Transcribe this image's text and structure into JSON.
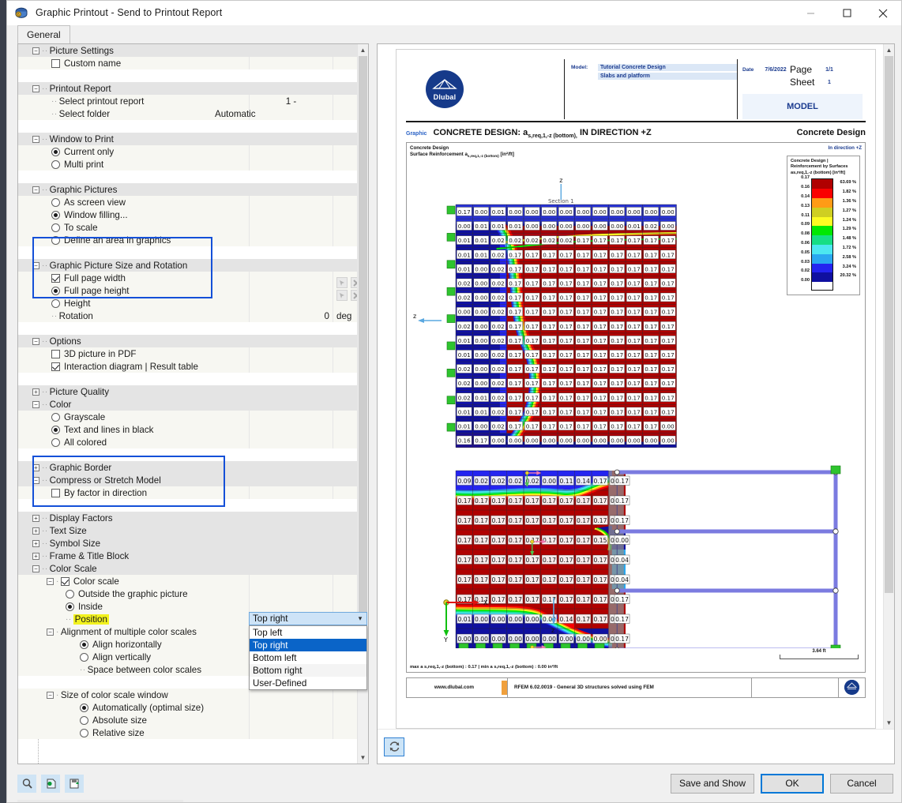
{
  "window": {
    "title": "Graphic Printout - Send to Printout Report",
    "icon": "printer-graphic-icon",
    "minimize": "—",
    "maximize": "☐",
    "close": "✕"
  },
  "tabs": [
    {
      "label": "General",
      "active": true
    }
  ],
  "tree": {
    "sections": [
      {
        "type": "group",
        "label": "Picture Settings",
        "expander": "−"
      },
      {
        "type": "check",
        "label": "Custom name",
        "checked": false
      },
      {
        "type": "blank"
      },
      {
        "type": "group",
        "label": "Printout Report",
        "expander": "−"
      },
      {
        "type": "text",
        "label": "Select printout report",
        "value": "1 -"
      },
      {
        "type": "text",
        "label": "Select folder",
        "value": "Automatic"
      },
      {
        "type": "blank"
      },
      {
        "type": "group",
        "label": "Window to Print",
        "expander": "−"
      },
      {
        "type": "radio",
        "label": "Current only",
        "checked": true
      },
      {
        "type": "radio",
        "label": "Multi print",
        "checked": false
      },
      {
        "type": "blank"
      },
      {
        "type": "group",
        "label": "Graphic Pictures",
        "expander": "−"
      },
      {
        "type": "radio",
        "label": "As screen view",
        "checked": false
      },
      {
        "type": "radio",
        "label": "Window filling...",
        "checked": true
      },
      {
        "type": "radio",
        "label": "To scale",
        "checked": false
      },
      {
        "type": "radio",
        "label": "Define an area in graphics",
        "checked": false
      },
      {
        "type": "blank"
      },
      {
        "type": "group",
        "label": "Graphic Picture Size and Rotation",
        "expander": "−"
      },
      {
        "type": "check",
        "label": "Full page width",
        "checked": true
      },
      {
        "type": "radio",
        "label": "Full page height",
        "checked": true
      },
      {
        "type": "radio",
        "label": "Height",
        "checked": false
      },
      {
        "type": "text",
        "label": "Rotation",
        "value": "0",
        "unit": "deg"
      },
      {
        "type": "blank"
      },
      {
        "type": "group",
        "label": "Options",
        "expander": "−"
      },
      {
        "type": "check",
        "label": "3D picture in PDF",
        "checked": false
      },
      {
        "type": "check",
        "label": "Interaction diagram | Result table",
        "checked": true
      },
      {
        "type": "blank"
      },
      {
        "type": "group",
        "label": "Picture Quality",
        "expander": "+"
      },
      {
        "type": "group",
        "label": "Color",
        "expander": "−"
      },
      {
        "type": "radio",
        "label": "Grayscale",
        "checked": false
      },
      {
        "type": "radio",
        "label": "Text and lines in black",
        "checked": true
      },
      {
        "type": "radio",
        "label": "All colored",
        "checked": false
      },
      {
        "type": "blank"
      },
      {
        "type": "group",
        "label": "Graphic Border",
        "expander": "+"
      },
      {
        "type": "group",
        "label": "Compress or Stretch Model",
        "expander": "−"
      },
      {
        "type": "check",
        "label": "By factor in direction",
        "checked": false
      },
      {
        "type": "blank"
      },
      {
        "type": "group",
        "label": "Display Factors",
        "expander": "+"
      },
      {
        "type": "group",
        "label": "Text Size",
        "expander": "+"
      },
      {
        "type": "group",
        "label": "Symbol Size",
        "expander": "+"
      },
      {
        "type": "group",
        "label": "Frame & Title Block",
        "expander": "+"
      },
      {
        "type": "group",
        "label": "Color Scale",
        "expander": "−"
      },
      {
        "type": "subcheck",
        "label": "Color scale",
        "checked": true,
        "expander": "−"
      },
      {
        "type": "radio2",
        "label": "Outside the graphic picture",
        "checked": false
      },
      {
        "type": "radio2",
        "label": "Inside",
        "checked": true
      },
      {
        "type": "hltext",
        "label": "Position",
        "value": "Top right"
      },
      {
        "type": "subgroup",
        "label": "Alignment of multiple color scales",
        "expander": "−"
      },
      {
        "type": "radio3",
        "label": "Align horizontally",
        "checked": true
      },
      {
        "type": "radio3",
        "label": "Align vertically",
        "checked": false
      },
      {
        "type": "plain3",
        "label": "Space between color scales"
      },
      {
        "type": "blank"
      },
      {
        "type": "subgroup",
        "label": "Size of color scale window",
        "expander": "−"
      },
      {
        "type": "radio3",
        "label": "Automatically (optimal size)",
        "checked": true
      },
      {
        "type": "radio3",
        "label": "Absolute size",
        "checked": false
      },
      {
        "type": "radio3",
        "label": "Relative size",
        "checked": false
      }
    ]
  },
  "dropdown": {
    "selected": "Top right",
    "arrow_icon": "chevron-down-icon",
    "options": [
      "Top left",
      "Top right",
      "Bottom left",
      "Bottom right",
      "User-Defined"
    ],
    "highlighted": "Top right"
  },
  "preview": {
    "header": {
      "logo_text": "Dlubal",
      "model_key": "Model:",
      "model_value": "Tutorial Concrete Design",
      "model_value2": "Slabs and platform",
      "date_key": "Date",
      "date_value": "7/6/2022",
      "page_key": "Page",
      "page_value": "1/1",
      "sheet_key": "Sheet",
      "sheet_value": "1",
      "model_box": "MODEL"
    },
    "graphic_title": {
      "tag": "Graphic",
      "main_prefix": "CONCRETE DESIGN: ",
      "main_symbol": "a",
      "main_symbol_sub": "s,req,1,-z (bottom),",
      "main_suffix": " IN DIRECTION +Z",
      "right": "Concrete Design"
    },
    "graphic": {
      "top_left_line1": "Concrete Design",
      "top_left_line2": "Surface Reinforcement a",
      "top_left_sub": "s,req,1,-z (bottom)",
      "top_left_unit": "[in²/ft]",
      "top_right": "In direction +Z",
      "section_label": "Section 1",
      "axis_x": "X",
      "axis_y": "Y",
      "axis_z": "z",
      "maxmin": "max a s,req,1,-z (bottom) : 0.17 | min a s,req,1,-z (bottom) : 0.00 in²/ft",
      "scale_label": "3.64 ft"
    },
    "footer": {
      "website": "www.dlubal.com",
      "version": "RFEM 6.02.0019 - General 3D structures solved using FEM"
    },
    "refresh_icon": "refresh-icon"
  },
  "chart_data": {
    "type": "heatmap",
    "title": "CONCRETE DESIGN: as,req,1,-z (bottom), IN DIRECTION +Z",
    "subtitle": "Surface Reinforcement as,req,1,-z (bottom) [in²/ft]",
    "unit": "in²/ft",
    "legend_title": "Concrete Design | Reinforcement by Surfaces",
    "legend_subtitle": "as,req,1,-z (bottom) [in²/ft]",
    "legend_position": "Top right",
    "max_value": 0.17,
    "min_value": 0.0,
    "boundaries": [
      0.17,
      0.16,
      0.14,
      0.13,
      0.11,
      0.09,
      0.08,
      0.06,
      0.05,
      0.03,
      0.02,
      0.0
    ],
    "band_colors": [
      "#b00000",
      "#fa0000",
      "#ff9b16",
      "#cfcf22",
      "#fcfc22",
      "#00e800",
      "#16de84",
      "#4ce8f0",
      "#2aa8f0",
      "#2424f0",
      "#1010a0"
    ],
    "band_percents": [
      "63.69 %",
      "1.82 %",
      "1.36 %",
      "1.27 %",
      "1.24 %",
      "1.29 %",
      "1.48 %",
      "1.72 %",
      "2.58 %",
      "3.24 %",
      "20.32 %"
    ],
    "upper_grid_rows": [
      [
        "0.17",
        "0.00",
        "0.01",
        "0.00",
        "0.00",
        "0.00",
        "0.00",
        "0.00",
        "0.00",
        "0.00",
        "0.00",
        "0.00",
        "0.00"
      ],
      [
        "0.00",
        "0.01",
        "0.01",
        "0.01",
        "0.00",
        "0.00",
        "0.00",
        "0.00",
        "0.00",
        "0.00",
        "0.01",
        "0.02",
        "0.00"
      ],
      [
        "0.01",
        "0.01",
        "0.02",
        "0.02",
        "0.02",
        "0.02",
        "0.02",
        "0.17",
        "0.17",
        "0.17",
        "0.17",
        "0.17",
        "0.17"
      ],
      [
        "0.01",
        "0.01",
        "0.02",
        "0.17",
        "0.17",
        "0.17",
        "0.17",
        "0.17",
        "0.17",
        "0.17",
        "0.17",
        "0.17",
        "0.17"
      ],
      [
        "0.01",
        "0.00",
        "0.02",
        "0.17",
        "0.17",
        "0.17",
        "0.17",
        "0.17",
        "0.17",
        "0.17",
        "0.17",
        "0.17",
        "0.17"
      ],
      [
        "0.02",
        "0.00",
        "0.02",
        "0.17",
        "0.17",
        "0.17",
        "0.17",
        "0.17",
        "0.17",
        "0.17",
        "0.17",
        "0.17",
        "0.17"
      ],
      [
        "0.02",
        "0.00",
        "0.02",
        "0.17",
        "0.17",
        "0.17",
        "0.17",
        "0.17",
        "0.17",
        "0.17",
        "0.17",
        "0.17",
        "0.17"
      ],
      [
        "0.00",
        "0.00",
        "0.02",
        "0.17",
        "0.17",
        "0.17",
        "0.17",
        "0.17",
        "0.17",
        "0.17",
        "0.17",
        "0.17",
        "0.17"
      ],
      [
        "0.02",
        "0.00",
        "0.02",
        "0.17",
        "0.17",
        "0.17",
        "0.17",
        "0.17",
        "0.17",
        "0.17",
        "0.17",
        "0.17",
        "0.17"
      ],
      [
        "0.01",
        "0.00",
        "0.02",
        "0.17",
        "0.17",
        "0.17",
        "0.17",
        "0.17",
        "0.17",
        "0.17",
        "0.17",
        "0.17",
        "0.17"
      ],
      [
        "0.01",
        "0.00",
        "0.02",
        "0.17",
        "0.17",
        "0.17",
        "0.17",
        "0.17",
        "0.17",
        "0.17",
        "0.17",
        "0.17",
        "0.17"
      ],
      [
        "0.02",
        "0.00",
        "0.02",
        "0.17",
        "0.17",
        "0.17",
        "0.17",
        "0.17",
        "0.17",
        "0.17",
        "0.17",
        "0.17",
        "0.17"
      ],
      [
        "0.02",
        "0.00",
        "0.02",
        "0.17",
        "0.17",
        "0.17",
        "0.17",
        "0.17",
        "0.17",
        "0.17",
        "0.17",
        "0.17",
        "0.17"
      ],
      [
        "0.02",
        "0.01",
        "0.02",
        "0.17",
        "0.17",
        "0.17",
        "0.17",
        "0.17",
        "0.17",
        "0.17",
        "0.17",
        "0.17",
        "0.17"
      ],
      [
        "0.01",
        "0.01",
        "0.02",
        "0.17",
        "0.17",
        "0.17",
        "0.17",
        "0.17",
        "0.17",
        "0.17",
        "0.17",
        "0.17",
        "0.17"
      ],
      [
        "0.01",
        "0.00",
        "0.02",
        "0.17",
        "0.17",
        "0.17",
        "0.17",
        "0.17",
        "0.17",
        "0.17",
        "0.17",
        "0.17",
        "0.00"
      ],
      [
        "0.16",
        "0.17",
        "0.00",
        "0.00",
        "0.00",
        "0.00",
        "0.00",
        "0.00",
        "0.00",
        "0.00",
        "0.00",
        "0.00",
        "0.00"
      ]
    ],
    "lower_grid_rows": [
      [
        "0.09",
        "0.02",
        "0.02",
        "0.02",
        "0.02",
        "0.00",
        "0.11",
        "0.14",
        "0.17",
        "0.17"
      ],
      [
        "0.17",
        "0.17",
        "0.17",
        "0.17",
        "0.17",
        "0.17",
        "0.17",
        "0.17",
        "0.17",
        "0.17"
      ],
      [
        "0.17",
        "0.17",
        "0.17",
        "0.17",
        "0.17",
        "0.17",
        "0.17",
        "0.17",
        "0.17",
        "0.17"
      ],
      [
        "0.17",
        "0.17",
        "0.17",
        "0.17",
        "0.17",
        "0.17",
        "0.17",
        "0.17",
        "0.15",
        "0.00"
      ],
      [
        "0.17",
        "0.17",
        "0.17",
        "0.17",
        "0.17",
        "0.17",
        "0.17",
        "0.17",
        "0.17",
        "0.04"
      ],
      [
        "0.17",
        "0.17",
        "0.17",
        "0.17",
        "0.17",
        "0.17",
        "0.17",
        "0.17",
        "0.17",
        "0.04"
      ],
      [
        "0.17",
        "0.17",
        "0.17",
        "0.17",
        "0.17",
        "0.17",
        "0.17",
        "0.17",
        "0.17",
        "0.17"
      ],
      [
        "0.01",
        "0.00",
        "0.00",
        "0.00",
        "0.00",
        "0.02",
        "0.14",
        "0.17",
        "0.17",
        "0.17"
      ],
      [
        "0.00",
        "0.00",
        "0.00",
        "0.00",
        "0.00",
        "0.00",
        "0.00",
        "0.00",
        "0.00",
        "0.17"
      ]
    ]
  },
  "footer_bar": {
    "tool_icons": [
      "zoom-preview-icon",
      "settings-preview-icon",
      "save-settings-icon"
    ],
    "save_and_show": "Save and Show",
    "ok": "OK",
    "cancel": "Cancel"
  }
}
